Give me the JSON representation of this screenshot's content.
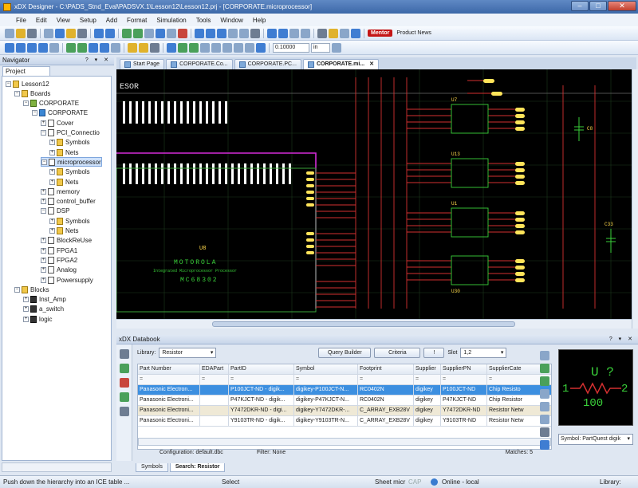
{
  "window": {
    "title": "xDX Designer - C:\\PADS_Stnd_Eval\\PADSVX.1\\Lesson12\\Lesson12.prj - [CORPORATE.microprocessor]"
  },
  "menu": [
    "File",
    "Edit",
    "View",
    "Setup",
    "Add",
    "Format",
    "Simulation",
    "Tools",
    "Window",
    "Help"
  ],
  "toolbar": {
    "brand": "Mentor",
    "news": "Product News",
    "grid_value": "0.10000",
    "unit": "in"
  },
  "navigator": {
    "title": "Navigator",
    "controls": "? ▾ ✕",
    "tab": "Project",
    "tree": [
      {
        "label": "Lesson12",
        "indent": 0,
        "icon": "fold",
        "exp": "−"
      },
      {
        "label": "Boards",
        "indent": 1,
        "icon": "fold",
        "exp": "−"
      },
      {
        "label": "CORPORATE",
        "indent": 2,
        "icon": "brd",
        "exp": "−"
      },
      {
        "label": "CORPORATE",
        "indent": 3,
        "icon": "sym",
        "exp": "−"
      },
      {
        "label": "Cover",
        "indent": 4,
        "icon": "page",
        "exp": "+"
      },
      {
        "label": "PCI_Connectio",
        "indent": 4,
        "icon": "page",
        "exp": "−"
      },
      {
        "label": "Symbols",
        "indent": 5,
        "icon": "fold",
        "exp": "+"
      },
      {
        "label": "Nets",
        "indent": 5,
        "icon": "fold",
        "exp": "+"
      },
      {
        "label": "microprocessor",
        "indent": 4,
        "icon": "page",
        "exp": "−",
        "selected": true
      },
      {
        "label": "Symbols",
        "indent": 5,
        "icon": "fold",
        "exp": "+"
      },
      {
        "label": "Nets",
        "indent": 5,
        "icon": "fold",
        "exp": "+"
      },
      {
        "label": "memory",
        "indent": 4,
        "icon": "page",
        "exp": "+"
      },
      {
        "label": "control_buffer",
        "indent": 4,
        "icon": "page",
        "exp": "+"
      },
      {
        "label": "DSP",
        "indent": 4,
        "icon": "page",
        "exp": "−"
      },
      {
        "label": "Symbols",
        "indent": 5,
        "icon": "fold",
        "exp": "+"
      },
      {
        "label": "Nets",
        "indent": 5,
        "icon": "fold",
        "exp": "+"
      },
      {
        "label": "BlockReUse",
        "indent": 4,
        "icon": "page",
        "exp": "+"
      },
      {
        "label": "FPGA1",
        "indent": 4,
        "icon": "page",
        "exp": "+"
      },
      {
        "label": "FPGA2",
        "indent": 4,
        "icon": "page",
        "exp": "+"
      },
      {
        "label": "Analog",
        "indent": 4,
        "icon": "page",
        "exp": "+"
      },
      {
        "label": "Powersupply",
        "indent": 4,
        "icon": "page",
        "exp": "+"
      },
      {
        "label": "Blocks",
        "indent": 1,
        "icon": "fold",
        "exp": "−"
      },
      {
        "label": "Inst_Amp",
        "indent": 2,
        "icon": "blk",
        "exp": "+"
      },
      {
        "label": "a_switch",
        "indent": 2,
        "icon": "blk",
        "exp": "+"
      },
      {
        "label": "logic",
        "indent": 2,
        "icon": "blk",
        "exp": "+"
      }
    ]
  },
  "doc_tabs": [
    {
      "label": "Start Page",
      "active": false
    },
    {
      "label": "CORPORATE.Co...",
      "active": false
    },
    {
      "label": "CORPORATE.PC...",
      "active": false
    },
    {
      "label": "CORPORATE.mi...",
      "active": true
    }
  ],
  "doc_tab_close": "✕",
  "schematic": {
    "header_text": "ESOR",
    "chip_ref": "U8",
    "chip_name": "MOTOROLA",
    "chip_desc": "Integrated Microprocessor Processor",
    "chip_part": "MC68302",
    "u7": "U7",
    "u13": "U13",
    "u1": "U1",
    "u30": "U30",
    "cap1": "C8",
    "cap2": "C33"
  },
  "databook": {
    "title": "xDX Databook",
    "controls": "? ▾ ✕",
    "library_label": "Library:",
    "library_value": "Resistor",
    "query_builder": "Query Builder",
    "criteria": "Criteria",
    "i_btn": "!",
    "slot_label": "Slot",
    "slot_value": "1,2",
    "columns": [
      "Part Number",
      "EDAPart",
      "PartID",
      "Symbol",
      "Footprint",
      "Supplier",
      "SupplierPN",
      "SupplierCate"
    ],
    "filter": "=",
    "rows": [
      [
        "Panasonic Electron...",
        "",
        "P100JCT-ND - digik...",
        "digikey-P100JCT-N...",
        "RC0402N",
        "digikey",
        "P100JCT-ND",
        "Chip Resisto"
      ],
      [
        "Panasonic Electroni...",
        "",
        "P47KJCT-ND - digik...",
        "digikey-P47KJCT-N...",
        "RC0402N",
        "digikey",
        "P47KJCT-ND",
        "Chip Resistor"
      ],
      [
        "Panasonic Electroni...",
        "",
        "Y7472DKR-ND - digi...",
        "digikey-Y7472DKR-...",
        "C_ARRAY_EXB28V",
        "digikey",
        "Y7472DKR-ND",
        "Resistor Netw"
      ],
      [
        "Panasonic Electroni...",
        "",
        "Y9103TR-ND - digik...",
        "digikey-Y9103TR-N...",
        "C_ARRAY_EXB28V",
        "digikey",
        "Y9103TR-ND",
        "Resistor Netw"
      ]
    ],
    "configuration": "Configuration: default.dbc",
    "filter_status": "Filter: None",
    "matches": "Matches: 5",
    "symbol_select": "Symbol: PartQuest digik",
    "preview": {
      "ref": "U ?",
      "val": "100",
      "pin1": "1",
      "pin2": "2"
    }
  },
  "bottom_tabs": [
    "Symbols",
    "Search: Resistor"
  ],
  "status": {
    "hint": "Push down the hierarchy into an ICE table ...",
    "mode": "Select",
    "sheet": "Sheet micr",
    "cap": "CAP",
    "online": "Online - local",
    "library": "Library:"
  }
}
